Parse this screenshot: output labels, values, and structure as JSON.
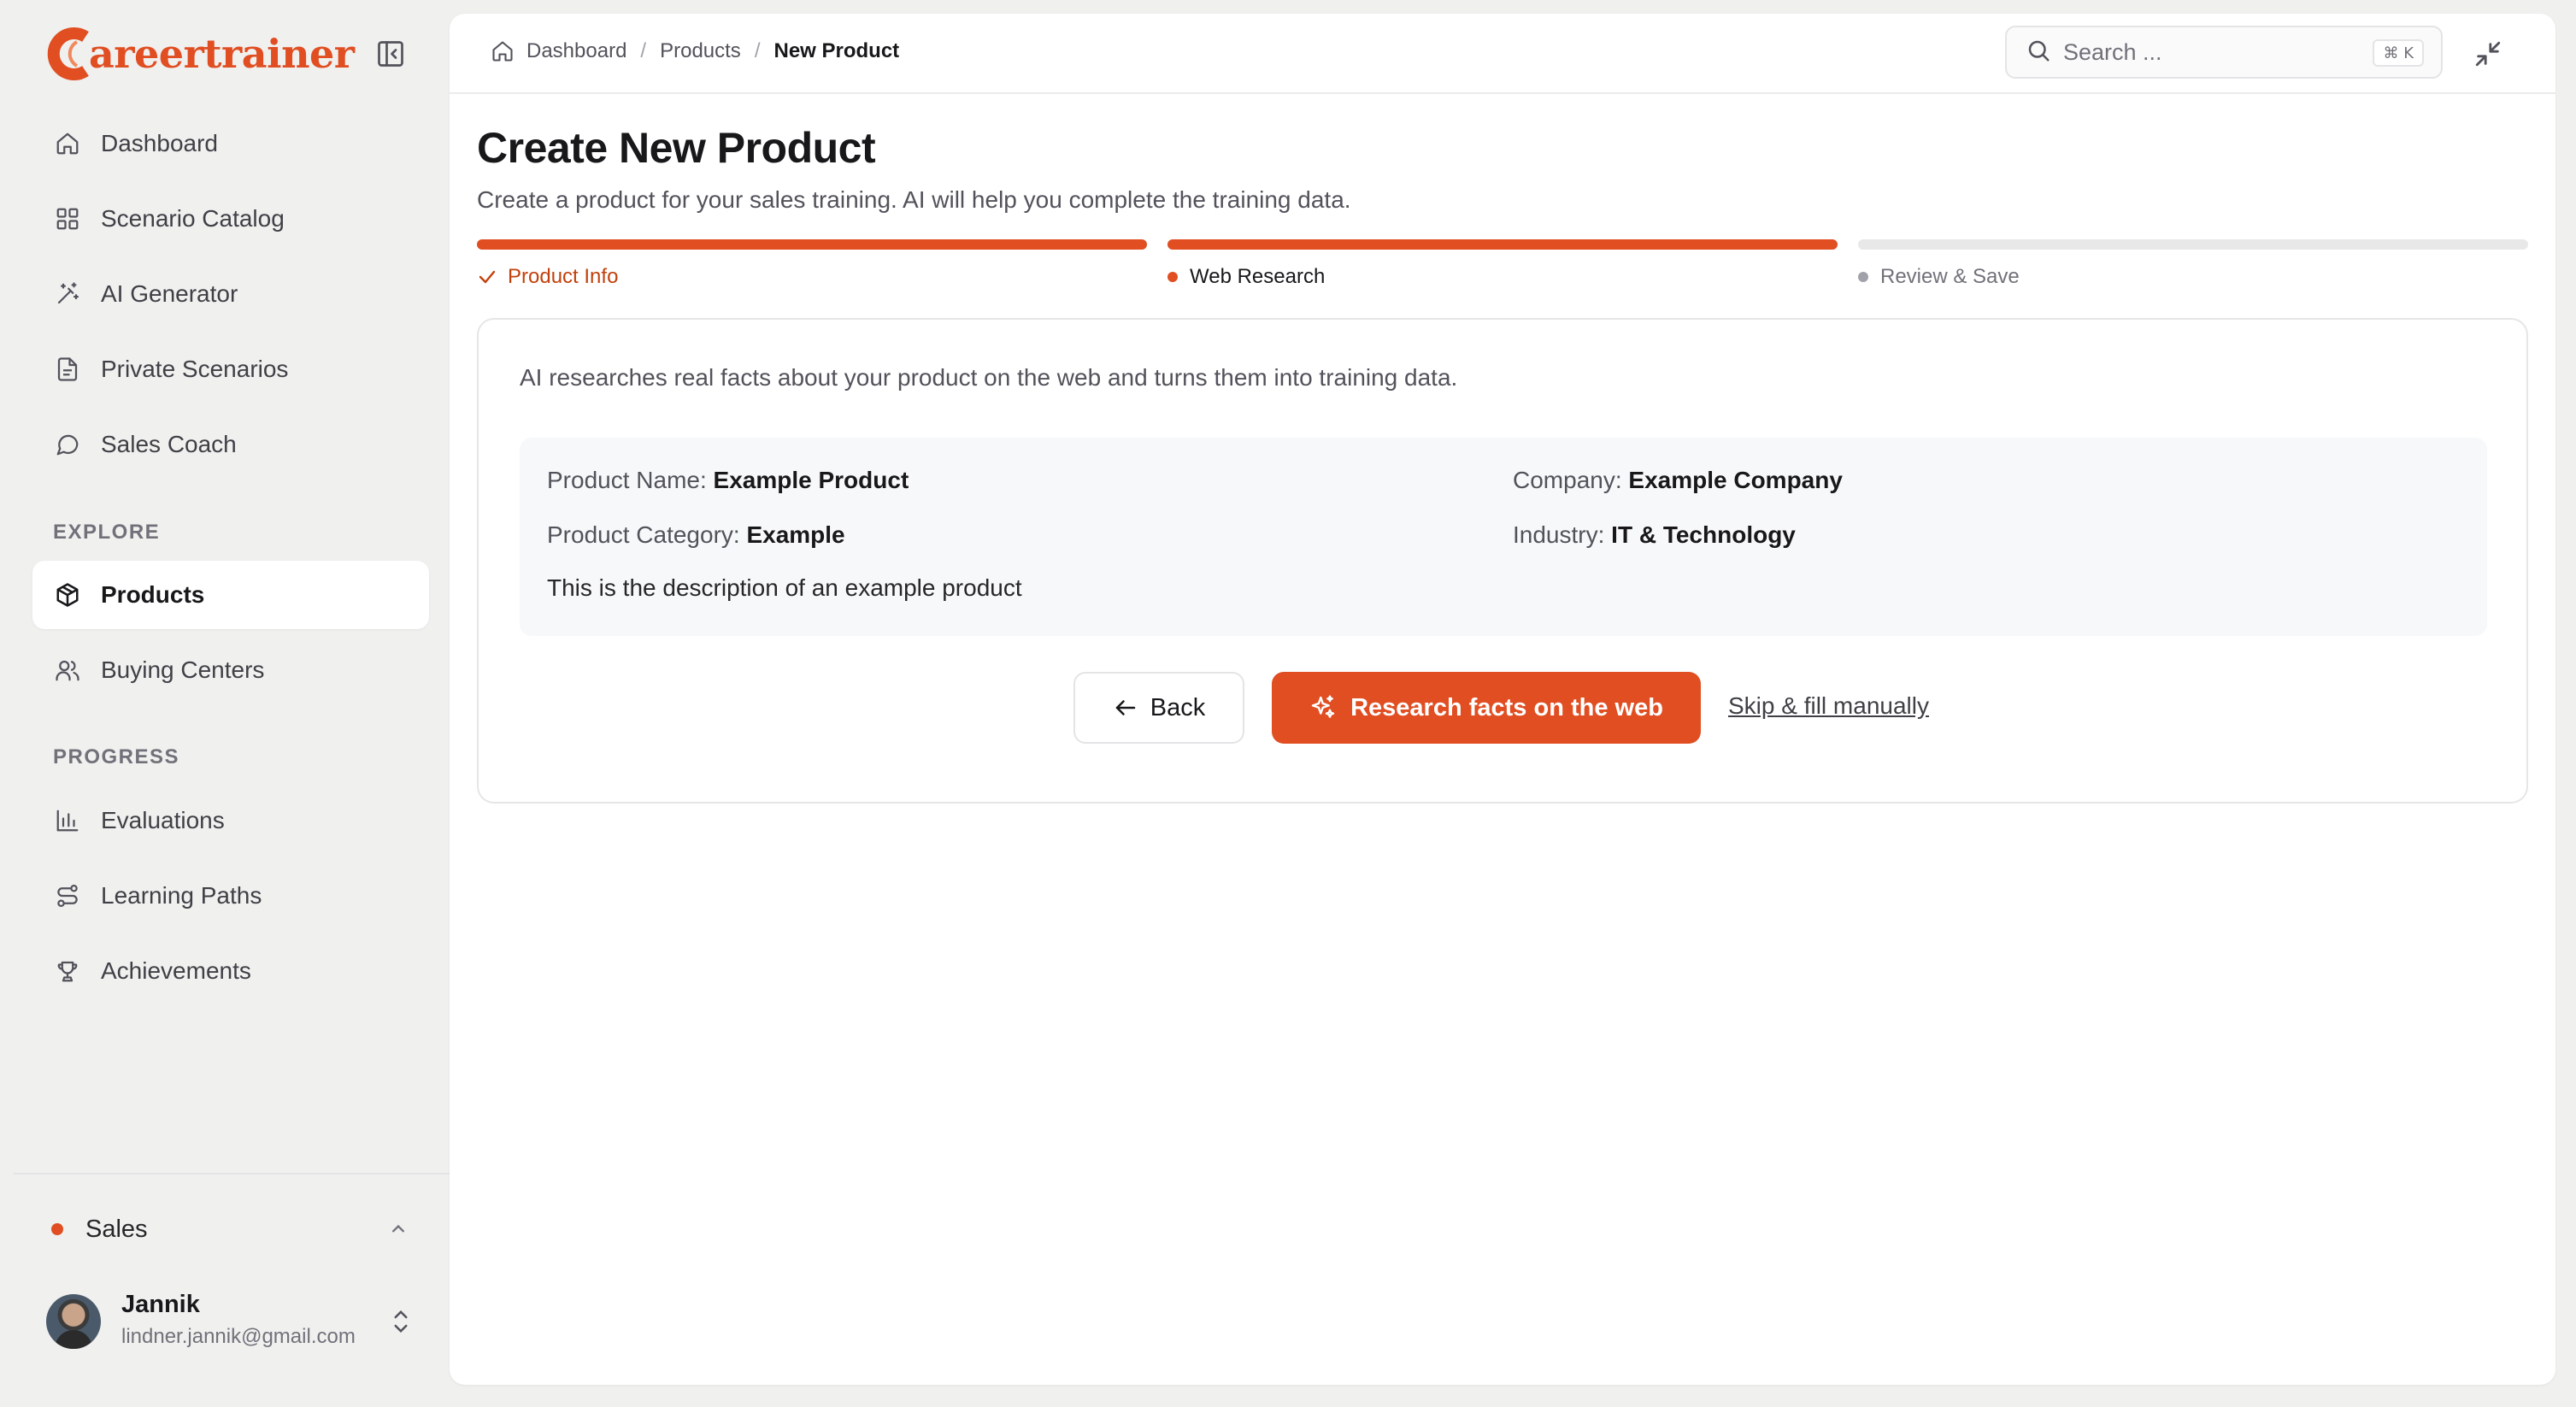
{
  "app": {
    "logo_text": "areertrainer",
    "brand_color": "#e04e22"
  },
  "sidebar": {
    "items": [
      {
        "label": "Dashboard",
        "icon": "home-icon"
      },
      {
        "label": "Scenario Catalog",
        "icon": "grid-icon"
      },
      {
        "label": "AI Generator",
        "icon": "wand-icon"
      },
      {
        "label": "Private Scenarios",
        "icon": "file-icon"
      },
      {
        "label": "Sales Coach",
        "icon": "chat-icon"
      }
    ],
    "explore_label": "EXPLORE",
    "explore_items": [
      {
        "label": "Products",
        "icon": "box-icon",
        "active": true
      },
      {
        "label": "Buying Centers",
        "icon": "users-icon"
      }
    ],
    "progress_label": "PROGRESS",
    "progress_items": [
      {
        "label": "Evaluations",
        "icon": "bar-chart-icon"
      },
      {
        "label": "Learning Paths",
        "icon": "route-icon"
      },
      {
        "label": "Achievements",
        "icon": "trophy-icon"
      }
    ],
    "team": {
      "name": "Sales"
    },
    "user": {
      "name": "Jannik",
      "email": "lindner.jannik@gmail.com"
    }
  },
  "header": {
    "breadcrumb": [
      "Dashboard",
      "Products",
      "New Product"
    ],
    "search_placeholder": "Search ...",
    "shortcut": "⌘ K"
  },
  "main": {
    "title": "Create New Product",
    "subtitle": "Create a product for your sales training. AI will help you complete the training data.",
    "steps": [
      {
        "label": "Product Info",
        "state": "done"
      },
      {
        "label": "Web Research",
        "state": "current"
      },
      {
        "label": "Review & Save",
        "state": "pending"
      }
    ],
    "card": {
      "intro": "AI researches real facts about your product on the web and turns them into training data.",
      "product_name_label": "Product Name:",
      "product_name": "Example Product",
      "company_label": "Company:",
      "company": "Example Company",
      "category_label": "Product Category:",
      "category": "Example",
      "industry_label": "Industry:",
      "industry": "IT & Technology",
      "description": "This is the description of an example product"
    },
    "buttons": {
      "back": "Back",
      "research": "Research facts on the web",
      "skip": "Skip & fill manually"
    }
  }
}
